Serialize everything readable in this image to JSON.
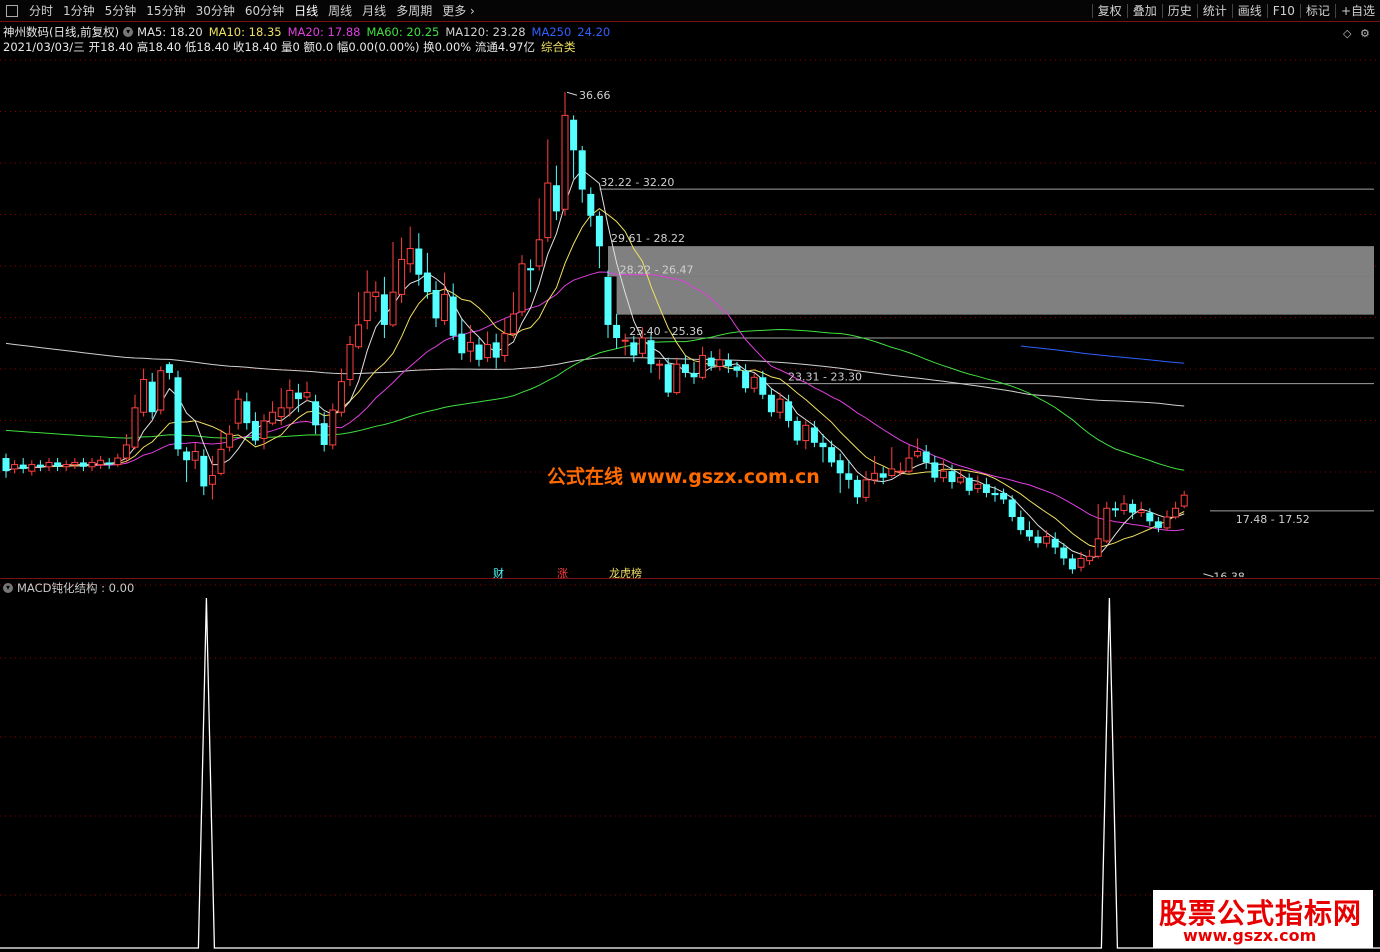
{
  "toolbar": {
    "periods": [
      "分时",
      "1分钟",
      "5分钟",
      "15分钟",
      "30分钟",
      "60分钟",
      "日线",
      "周线",
      "月线",
      "多周期",
      "更多"
    ],
    "active_period": "日线",
    "right_buttons": [
      "复权",
      "叠加",
      "历史",
      "统计",
      "画线",
      "F10",
      "标记",
      "+自选"
    ]
  },
  "stock": {
    "name": "神州数码",
    "mode": "(日线,前复权)",
    "date": "2021/03/03/三",
    "info_line": "开18.40 高18.40 低18.40 收18.40 量0 额0.0 幅0.00(0.00%) 换0.00% 流通4.97亿",
    "sector": "综合类"
  },
  "ma_legend": [
    {
      "label": "MA5: 18.20",
      "color": "#e0e0e0"
    },
    {
      "label": "MA10: 18.35",
      "color": "#f0e060"
    },
    {
      "label": "MA20: 17.88",
      "color": "#e040e0"
    },
    {
      "label": "MA60: 20.25",
      "color": "#40e040"
    },
    {
      "label": "MA120: 23.28",
      "color": "#d0d0d0"
    },
    {
      "label": "MA250",
      "color": "#3060ff"
    },
    {
      "label": "24.20",
      "color": "#3060ff"
    }
  ],
  "price_annotations": {
    "high": "36.66",
    "low": "16.38",
    "zones": [
      "32.22 - 32.20",
      "29.61 - 28.22",
      "28.22 - 26.47",
      "25.40 - 25.36",
      "23.31 - 23.30",
      "17.48 - 17.52"
    ]
  },
  "event_tags": [
    "财",
    "涨",
    "龙虎榜"
  ],
  "indicator": {
    "title": "MACD钝化结构 : 0.00"
  },
  "watermark": "公式在线 www.gszx.com.cn",
  "brand": {
    "line1": "股票公式指标网",
    "line2": "www.gszx.com"
  },
  "colors": {
    "up": "#ff4040",
    "down": "#54ffff",
    "grid": "#8b0000",
    "ma5": "#e0e0e0",
    "ma10": "#f0e060",
    "ma20": "#e040e0",
    "ma60": "#40e040",
    "ma120": "#d0d0d0",
    "ma250": "#3060ff",
    "zone_fill": "#808080"
  },
  "chart_data": {
    "type": "candlestick",
    "y_range": [
      15.0,
      38.0
    ],
    "candles": [
      [
        19.9,
        19.3,
        20.1,
        19.0
      ],
      [
        19.4,
        19.6,
        19.8,
        19.2
      ],
      [
        19.6,
        19.4,
        19.9,
        19.2
      ],
      [
        19.3,
        19.6,
        19.8,
        19.1
      ],
      [
        19.6,
        19.5,
        19.8,
        19.3
      ],
      [
        19.5,
        19.7,
        19.9,
        19.3
      ],
      [
        19.7,
        19.5,
        19.9,
        19.3
      ],
      [
        19.5,
        19.6,
        19.8,
        19.3
      ],
      [
        19.6,
        19.7,
        19.9,
        19.4
      ],
      [
        19.7,
        19.5,
        19.9,
        19.3
      ],
      [
        19.5,
        19.7,
        19.9,
        19.3
      ],
      [
        19.6,
        19.8,
        20.0,
        19.4
      ],
      [
        19.7,
        19.6,
        19.9,
        19.4
      ],
      [
        19.6,
        19.9,
        20.1,
        19.5
      ],
      [
        19.9,
        20.5,
        21.0,
        19.7
      ],
      [
        20.4,
        22.2,
        22.8,
        20.3
      ],
      [
        22.0,
        23.5,
        24.0,
        21.8
      ],
      [
        23.4,
        22.0,
        23.8,
        21.7
      ],
      [
        22.1,
        23.9,
        24.1,
        21.9
      ],
      [
        24.2,
        23.8,
        24.3,
        23.5
      ],
      [
        23.6,
        20.3,
        23.9,
        20.0
      ],
      [
        20.2,
        19.8,
        20.4,
        18.8
      ],
      [
        19.8,
        20.2,
        20.6,
        19.4
      ],
      [
        20.0,
        18.6,
        20.3,
        18.2
      ],
      [
        18.7,
        19.1,
        20.0,
        18.0
      ],
      [
        19.2,
        20.3,
        21.2,
        19.1
      ],
      [
        20.4,
        21.0,
        21.4,
        20.2
      ],
      [
        21.5,
        22.6,
        23.0,
        21.2
      ],
      [
        22.5,
        21.5,
        22.9,
        21.2
      ],
      [
        21.6,
        20.7,
        22.0,
        20.5
      ],
      [
        20.8,
        21.6,
        21.9,
        20.3
      ],
      [
        21.5,
        22.0,
        22.5,
        21.4
      ],
      [
        21.8,
        22.2,
        23.1,
        21.4
      ],
      [
        22.2,
        23.0,
        23.5,
        21.8
      ],
      [
        22.9,
        22.6,
        23.3,
        22.0
      ],
      [
        22.7,
        22.9,
        23.4,
        22.5
      ],
      [
        22.5,
        21.4,
        22.8,
        21.0
      ],
      [
        21.5,
        20.5,
        22.0,
        20.2
      ],
      [
        20.5,
        22.1,
        22.4,
        20.3
      ],
      [
        22.0,
        23.4,
        24.0,
        21.8
      ],
      [
        23.5,
        25.1,
        25.5,
        23.2
      ],
      [
        25.0,
        26.0,
        27.5,
        24.9
      ],
      [
        26.2,
        27.5,
        28.5,
        25.8
      ],
      [
        27.3,
        27.5,
        28.0,
        26.6
      ],
      [
        27.4,
        26.0,
        28.2,
        25.4
      ],
      [
        26.0,
        27.5,
        29.8,
        25.9
      ],
      [
        27.4,
        29.0,
        30.0,
        27.0
      ],
      [
        28.8,
        29.5,
        30.5,
        28.4
      ],
      [
        29.5,
        28.3,
        30.2,
        27.8
      ],
      [
        28.4,
        27.5,
        29.3,
        27.2
      ],
      [
        27.6,
        26.3,
        28.0,
        25.9
      ],
      [
        26.2,
        27.4,
        28.4,
        26.0
      ],
      [
        27.3,
        25.5,
        27.9,
        25.3
      ],
      [
        25.6,
        24.7,
        26.3,
        24.4
      ],
      [
        24.8,
        25.2,
        26.0,
        24.3
      ],
      [
        25.1,
        24.4,
        25.4,
        24.1
      ],
      [
        24.5,
        25.1,
        25.7,
        24.3
      ],
      [
        25.2,
        24.5,
        25.6,
        24.0
      ],
      [
        24.6,
        25.6,
        26.3,
        24.3
      ],
      [
        25.6,
        26.5,
        27.5,
        25.4
      ],
      [
        26.6,
        28.8,
        29.2,
        26.4
      ],
      [
        28.6,
        28.5,
        29.0,
        27.5
      ],
      [
        28.7,
        29.9,
        31.8,
        28.5
      ],
      [
        30.0,
        32.5,
        34.5,
        29.8
      ],
      [
        32.4,
        31.2,
        33.3,
        30.8
      ],
      [
        31.3,
        35.6,
        36.66,
        31.0
      ],
      [
        35.4,
        34.0,
        35.6,
        32.7
      ],
      [
        34.0,
        32.2,
        34.2,
        31.6
      ],
      [
        32.0,
        31.0,
        32.3,
        30.5
      ],
      [
        31.0,
        29.6,
        31.2,
        28.6
      ],
      [
        28.2,
        26.0,
        28.5,
        25.4
      ],
      [
        26.0,
        25.4,
        26.5,
        24.9
      ],
      [
        25.3,
        25.3,
        25.6,
        24.6
      ],
      [
        25.2,
        24.6,
        25.5,
        24.3
      ],
      [
        24.7,
        25.4,
        25.9,
        24.5
      ],
      [
        25.3,
        24.2,
        25.6,
        23.8
      ],
      [
        24.2,
        24.2,
        24.4,
        23.5
      ],
      [
        24.2,
        22.9,
        24.5,
        22.7
      ],
      [
        22.9,
        24.2,
        24.5,
        22.8
      ],
      [
        24.2,
        23.8,
        24.6,
        23.6
      ],
      [
        23.8,
        23.6,
        24.3,
        23.3
      ],
      [
        23.6,
        24.6,
        25.0,
        23.5
      ],
      [
        24.5,
        24.1,
        24.8,
        23.9
      ],
      [
        24.1,
        24.4,
        24.9,
        23.9
      ],
      [
        24.4,
        24.1,
        24.7,
        23.8
      ],
      [
        24.1,
        23.9,
        24.3,
        23.6
      ],
      [
        23.9,
        23.1,
        24.2,
        22.9
      ],
      [
        23.1,
        23.6,
        23.8,
        22.9
      ],
      [
        23.6,
        22.8,
        23.9,
        22.6
      ],
      [
        22.8,
        22.0,
        23.1,
        21.8
      ],
      [
        22.0,
        22.6,
        22.9,
        21.7
      ],
      [
        22.5,
        21.6,
        22.8,
        21.3
      ],
      [
        21.6,
        20.7,
        21.8,
        20.5
      ],
      [
        20.7,
        21.4,
        21.6,
        20.3
      ],
      [
        21.3,
        20.6,
        21.6,
        20.4
      ],
      [
        20.6,
        20.4,
        21.0,
        19.7
      ],
      [
        20.4,
        19.7,
        20.7,
        19.5
      ],
      [
        19.8,
        19.2,
        20.1,
        18.3
      ],
      [
        19.2,
        18.9,
        19.8,
        18.5
      ],
      [
        18.9,
        18.1,
        19.1,
        17.8
      ],
      [
        18.1,
        18.9,
        19.3,
        17.9
      ],
      [
        18.9,
        19.2,
        20.0,
        18.7
      ],
      [
        19.2,
        19.0,
        19.5,
        18.7
      ],
      [
        19.1,
        19.4,
        20.4,
        19.0
      ],
      [
        19.3,
        19.3,
        19.7,
        19.1
      ],
      [
        19.3,
        19.9,
        20.5,
        19.2
      ],
      [
        20.0,
        20.2,
        20.8,
        19.9
      ],
      [
        20.2,
        19.7,
        20.5,
        19.4
      ],
      [
        19.7,
        19.0,
        20.0,
        18.8
      ],
      [
        19.0,
        19.3,
        19.8,
        18.8
      ],
      [
        19.3,
        18.8,
        19.6,
        18.5
      ],
      [
        18.8,
        19.0,
        19.4,
        18.7
      ],
      [
        19.0,
        18.4,
        19.2,
        18.2
      ],
      [
        18.5,
        18.7,
        19.1,
        18.3
      ],
      [
        18.7,
        18.3,
        19.0,
        18.1
      ],
      [
        18.3,
        18.2,
        18.6,
        17.9
      ],
      [
        18.3,
        18.0,
        18.5,
        17.8
      ],
      [
        18.0,
        17.2,
        18.2,
        17.0
      ],
      [
        17.2,
        16.6,
        17.5,
        16.4
      ],
      [
        16.6,
        16.3,
        17.0,
        16.1
      ],
      [
        16.3,
        16.0,
        16.6,
        15.8
      ],
      [
        16.0,
        16.3,
        16.6,
        15.8
      ],
      [
        16.2,
        15.8,
        16.5,
        15.5
      ],
      [
        15.8,
        15.3,
        16.0,
        15.0
      ],
      [
        15.3,
        14.8,
        15.5,
        14.6
      ],
      [
        14.9,
        15.3,
        15.6,
        14.7
      ],
      [
        15.2,
        15.4,
        15.7,
        15.0
      ],
      [
        15.4,
        16.2,
        17.8,
        15.3
      ],
      [
        16.1,
        17.6,
        17.9,
        16.0
      ],
      [
        17.6,
        17.5,
        17.9,
        17.2
      ],
      [
        17.5,
        17.8,
        18.2,
        17.3
      ],
      [
        17.8,
        17.4,
        18.0,
        17.1
      ],
      [
        17.4,
        17.5,
        17.9,
        17.2
      ],
      [
        17.4,
        17.0,
        17.6,
        16.8
      ],
      [
        17.0,
        16.7,
        17.2,
        16.5
      ],
      [
        16.7,
        17.2,
        17.5,
        16.6
      ],
      [
        17.2,
        17.6,
        17.9,
        17.1
      ],
      [
        17.7,
        18.2,
        18.4,
        17.6
      ]
    ],
    "indicator_spikes": [
      {
        "bar": 29,
        "value": 1.0
      },
      {
        "bar": 134,
        "value": 1.0
      }
    ],
    "indicator_range": [
      0,
      1
    ]
  }
}
